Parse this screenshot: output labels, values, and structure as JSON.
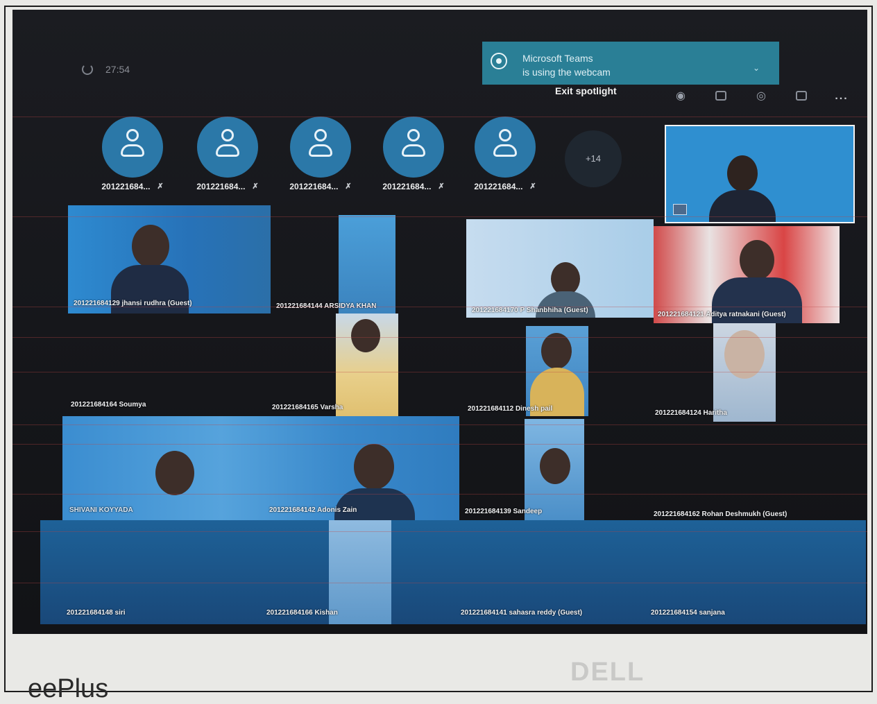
{
  "call": {
    "timer": "27:54",
    "toast_title": "Microsoft Teams",
    "toast_body": "is using the webcam",
    "exit_spotlight": "Exit spotlight",
    "more_participants": "+14",
    "more_menu": "..."
  },
  "avatars": [
    {
      "name": "201221684..."
    },
    {
      "name": "201221684..."
    },
    {
      "name": "201221684..."
    },
    {
      "name": "201221684..."
    },
    {
      "name": "201221684..."
    }
  ],
  "tiles": [
    {
      "label": "201221684129 jhansi rudhra (Guest)"
    },
    {
      "label": "201221684144 ARSIDYA KHAN"
    },
    {
      "label": "201221684170 P Shanbhiha (Guest)"
    },
    {
      "label": "201221684121 Aditya ratnakani (Guest)"
    },
    {
      "label": "201221684164 Soumya"
    },
    {
      "label": "201221684165 Varsha"
    },
    {
      "label": "201221684112 Dinesh pail"
    },
    {
      "label": "201221684124 Haritha"
    },
    {
      "label": "SHIVANI KOYYADA"
    },
    {
      "label": "201221684142 Adonis Zain"
    },
    {
      "label": "201221684139 Sandeep"
    },
    {
      "label": "201221684162 Rohan Deshmukh (Guest)"
    },
    {
      "label": "201221684148 siri"
    },
    {
      "label": "201221684166 Kishan"
    },
    {
      "label": "201221684141 sahasra reddy (Guest)"
    },
    {
      "label": "201221684154 sanjana"
    }
  ],
  "bezel": {
    "brand": "DELL",
    "corner": "eePlus"
  }
}
